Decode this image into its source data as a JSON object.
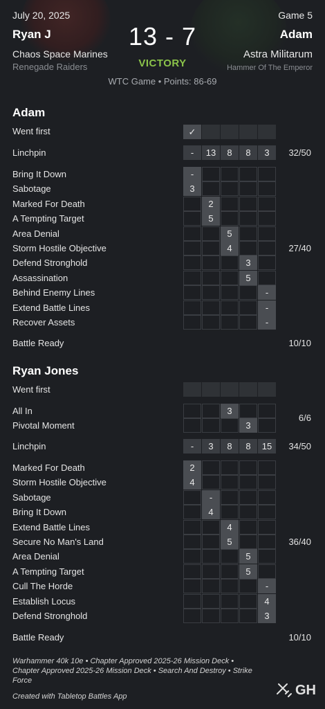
{
  "header": {
    "date": "July 20, 2025",
    "game_label": "Game 5",
    "score": "13 - 7",
    "result": "VICTORY",
    "game_info": "WTC Game • Points: 86-69",
    "left": {
      "name": "Ryan J",
      "faction": "Chaos Space Marines",
      "subfaction": "Renegade Raiders"
    },
    "right": {
      "name": "Adam",
      "faction": "Astra Militarum",
      "subfaction": "Hammer Of The Emperor"
    }
  },
  "adam": {
    "title": "Adam",
    "went_first": {
      "label": "Went first",
      "check": "✓"
    },
    "linchpin": {
      "label": "Linchpin",
      "values": [
        "-",
        "13",
        "8",
        "8",
        "3"
      ],
      "total": "32/50"
    },
    "secondaries": {
      "total": "27/40",
      "rows": [
        {
          "label": "Bring It Down",
          "round": 1,
          "value": "-"
        },
        {
          "label": "Sabotage",
          "round": 1,
          "value": "3"
        },
        {
          "label": "Marked For Death",
          "round": 2,
          "value": "2"
        },
        {
          "label": "A Tempting Target",
          "round": 2,
          "value": "5"
        },
        {
          "label": "Area Denial",
          "round": 3,
          "value": "5"
        },
        {
          "label": "Storm Hostile Objective",
          "round": 3,
          "value": "4"
        },
        {
          "label": "Defend Stronghold",
          "round": 4,
          "value": "3"
        },
        {
          "label": "Assassination",
          "round": 4,
          "value": "5"
        },
        {
          "label": "Behind Enemy Lines",
          "round": 5,
          "value": "-"
        },
        {
          "label": "Extend Battle Lines",
          "round": 5,
          "value": "-"
        },
        {
          "label": "Recover Assets",
          "round": 5,
          "value": "-"
        }
      ]
    },
    "battle_ready": {
      "label": "Battle Ready",
      "total": "10/10"
    }
  },
  "ryan": {
    "title": "Ryan Jones",
    "went_first": {
      "label": "Went first"
    },
    "gambits": {
      "total": "6/6",
      "rows": [
        {
          "label": "All In",
          "round": 3,
          "value": "3"
        },
        {
          "label": "Pivotal Moment",
          "round": 4,
          "value": "3"
        }
      ]
    },
    "linchpin": {
      "label": "Linchpin",
      "values": [
        "-",
        "3",
        "8",
        "8",
        "15"
      ],
      "total": "34/50"
    },
    "secondaries": {
      "total": "36/40",
      "rows": [
        {
          "label": "Marked For Death",
          "round": 1,
          "value": "2"
        },
        {
          "label": "Storm Hostile Objective",
          "round": 1,
          "value": "4"
        },
        {
          "label": "Sabotage",
          "round": 2,
          "value": "-"
        },
        {
          "label": "Bring It Down",
          "round": 2,
          "value": "4"
        },
        {
          "label": "Extend Battle Lines",
          "round": 3,
          "value": "4"
        },
        {
          "label": "Secure No Man's Land",
          "round": 3,
          "value": "5"
        },
        {
          "label": "Area Denial",
          "round": 4,
          "value": "5"
        },
        {
          "label": "A Tempting Target",
          "round": 4,
          "value": "5"
        },
        {
          "label": "Cull The Horde",
          "round": 5,
          "value": "-"
        },
        {
          "label": "Establish Locus",
          "round": 5,
          "value": "4"
        },
        {
          "label": "Defend Stronghold",
          "round": 5,
          "value": "3"
        }
      ]
    },
    "battle_ready": {
      "label": "Battle Ready",
      "total": "10/10"
    }
  },
  "footer": {
    "mission": "Warhammer 40k 10e • Chapter Approved 2025-26 Mission Deck • Chapter Approved 2025-26 Mission Deck • Search And Destroy • Strike Force",
    "credit": "Created with Tabletop Battles App",
    "logo_text": "GH",
    "logo_icon": "crossed-swords-icon"
  },
  "colors": {
    "victory": "#8bc34a",
    "background": "#1d1f23",
    "cell_filled": "#4a4d52"
  }
}
